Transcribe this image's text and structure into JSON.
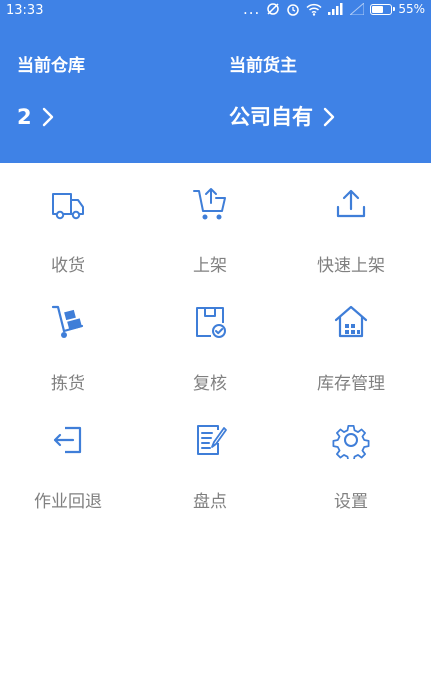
{
  "status_bar": {
    "time": "13:33",
    "dots": "...",
    "battery": "55%"
  },
  "header": {
    "warehouse_label": "当前仓库",
    "warehouse_value": "2",
    "owner_label": "当前货主",
    "owner_value": "公司自有"
  },
  "menu": [
    {
      "label": "收货",
      "icon": "truck-icon"
    },
    {
      "label": "上架",
      "icon": "cart-upload-icon"
    },
    {
      "label": "快速上架",
      "icon": "upload-icon"
    },
    {
      "label": "拣货",
      "icon": "hand-truck-icon"
    },
    {
      "label": "复核",
      "icon": "box-check-icon"
    },
    {
      "label": "库存管理",
      "icon": "warehouse-icon"
    },
    {
      "label": "作业回退",
      "icon": "logout-arrow-icon"
    },
    {
      "label": "盘点",
      "icon": "checklist-icon"
    },
    {
      "label": "设置",
      "icon": "gear-icon"
    }
  ],
  "colors": {
    "header_bg": "#3f82e6",
    "icon": "#3f7ed8",
    "label": "#808080"
  }
}
